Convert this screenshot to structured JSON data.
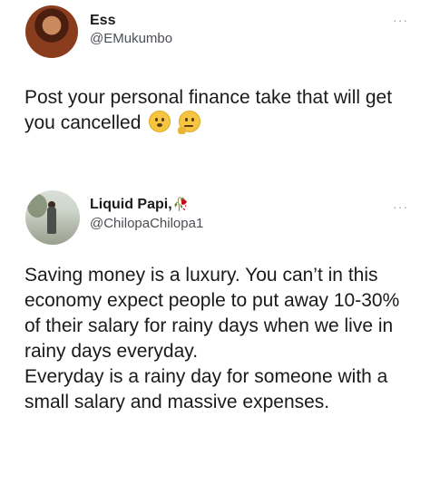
{
  "tweet1": {
    "name": "Ess",
    "handle": "@EMukumbo",
    "text": "Post your personal finance take that will get you cancelled",
    "emojis": [
      "hushed-face-emoji",
      "thinking-face-emoji"
    ],
    "more": "···"
  },
  "tweet2": {
    "name": "Liquid Papi,",
    "name_emoji": "rose-emoji",
    "handle": "@ChilopaChilopa1",
    "text_line1": "Saving money is a luxury. You can’t in this economy expect people to put away 10-30% of their salary for rainy days when we live in rainy days everyday.",
    "text_line2": "Everyday is a rainy day for someone with a small salary and massive expenses.",
    "more": "···"
  },
  "colors": {
    "text": "#1a1a1a",
    "handle": "#4b4f54",
    "more_icon": "#9aa0a6",
    "background": "#ffffff"
  }
}
